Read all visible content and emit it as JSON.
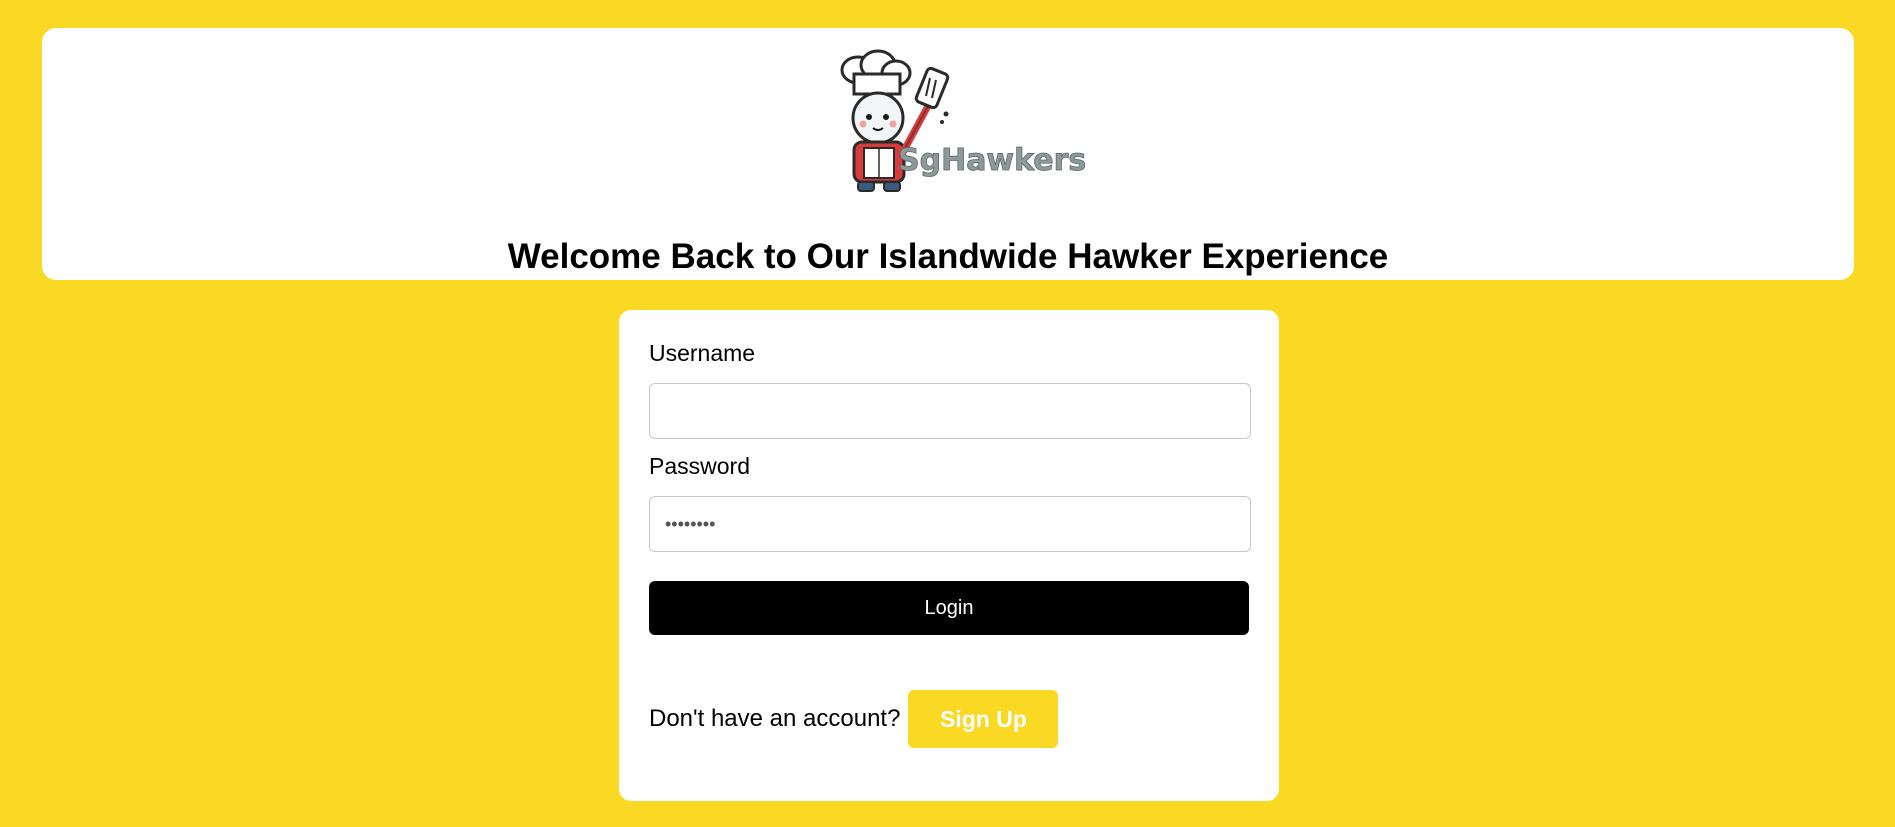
{
  "header": {
    "logo_text": "SgHawkers",
    "title": "Welcome Back to Our Islandwide Hawker Experience"
  },
  "login_form": {
    "username_label": "Username",
    "username_value": "",
    "password_label": "Password",
    "password_value": "password",
    "login_label": "Login"
  },
  "signup": {
    "prompt": "Don't have an account?",
    "button_label": "Sign Up"
  },
  "colors": {
    "background": "#fad924",
    "card": "#ffffff",
    "login_button": "#000000",
    "signup_button": "#fad924"
  },
  "icons": {
    "logo": "chef-with-spatula-logo"
  }
}
